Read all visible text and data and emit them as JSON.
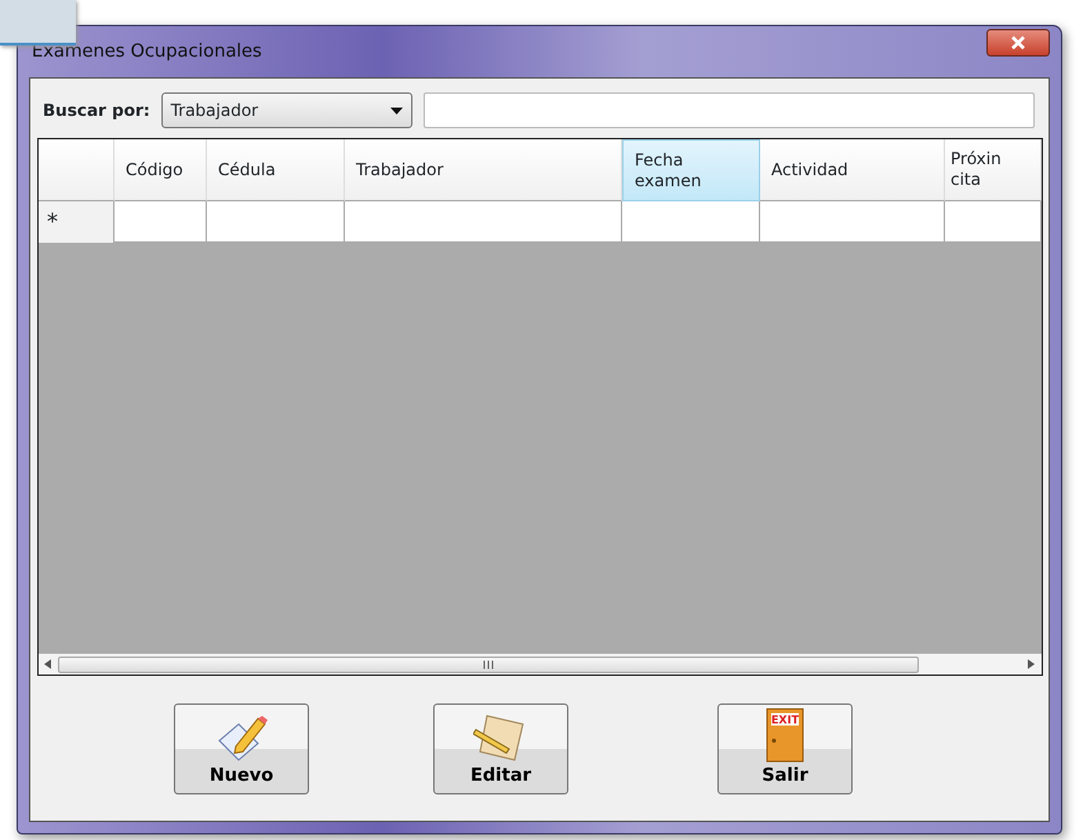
{
  "window": {
    "title": "Examenes Ocupacionales"
  },
  "search": {
    "label": "Buscar por:",
    "field": "Trabajador"
  },
  "table": {
    "columns": [
      {
        "label": "Código",
        "selected": false
      },
      {
        "label": "Cédula",
        "selected": false
      },
      {
        "label": "Trabajador",
        "selected": false
      },
      {
        "label": "Fecha examen",
        "selected": true
      },
      {
        "label": "Actividad",
        "selected": false
      },
      {
        "label": "Próxin cita",
        "selected": false
      }
    ],
    "new_row_marker": "*"
  },
  "buttons": [
    {
      "label": "Nuevo",
      "kind": "new"
    },
    {
      "label": "Editar",
      "kind": "edit"
    },
    {
      "label": "Salir",
      "kind": "exit",
      "icon_text": "EXIT"
    }
  ]
}
